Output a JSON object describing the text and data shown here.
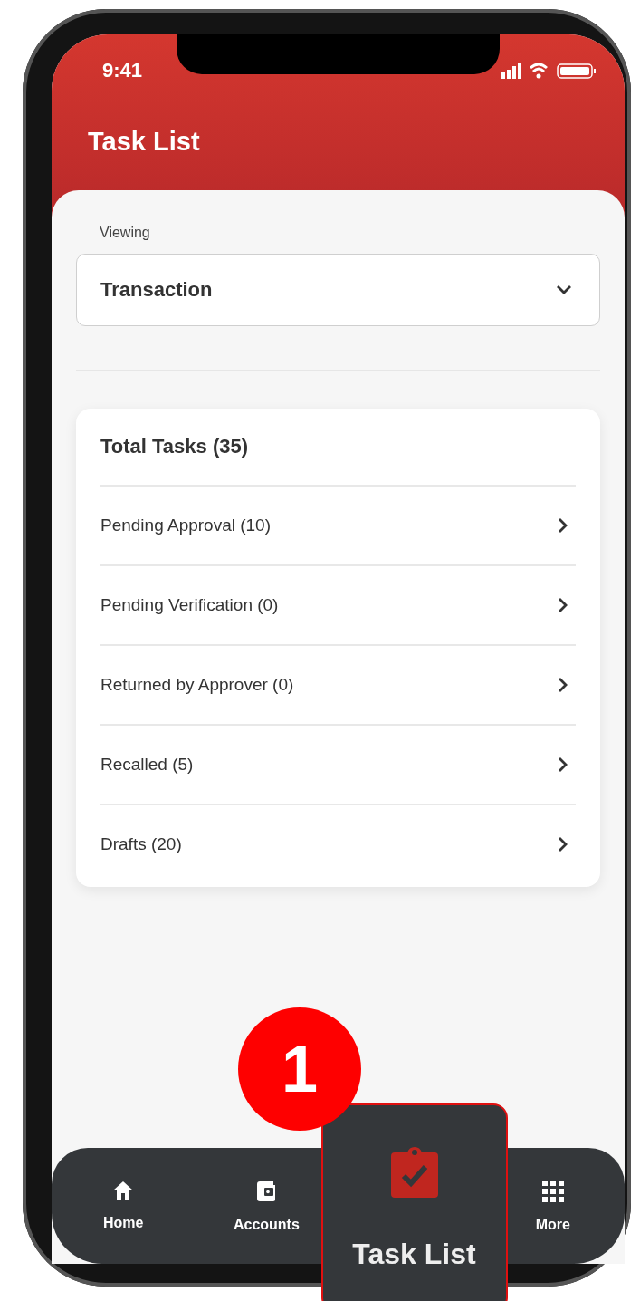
{
  "status_bar": {
    "time": "9:41"
  },
  "header": {
    "title": "Task List"
  },
  "viewing": {
    "label": "Viewing",
    "value": "Transaction"
  },
  "summary": {
    "title": "Total Tasks (35)",
    "items": [
      {
        "label": "Pending Approval (10)"
      },
      {
        "label": "Pending Verification (0)"
      },
      {
        "label": "Returned by Approver (0)"
      },
      {
        "label": "Recalled (5)"
      },
      {
        "label": "Drafts (20)"
      }
    ]
  },
  "nav": {
    "items": [
      {
        "label": "Home",
        "kind": "home",
        "selected": false
      },
      {
        "label": "Accounts",
        "kind": "wallet",
        "selected": false
      },
      {
        "label": "Task List",
        "kind": "clipboard",
        "selected": true
      },
      {
        "label": "More",
        "kind": "grid",
        "selected": false
      }
    ]
  },
  "callout": {
    "number": "1"
  }
}
